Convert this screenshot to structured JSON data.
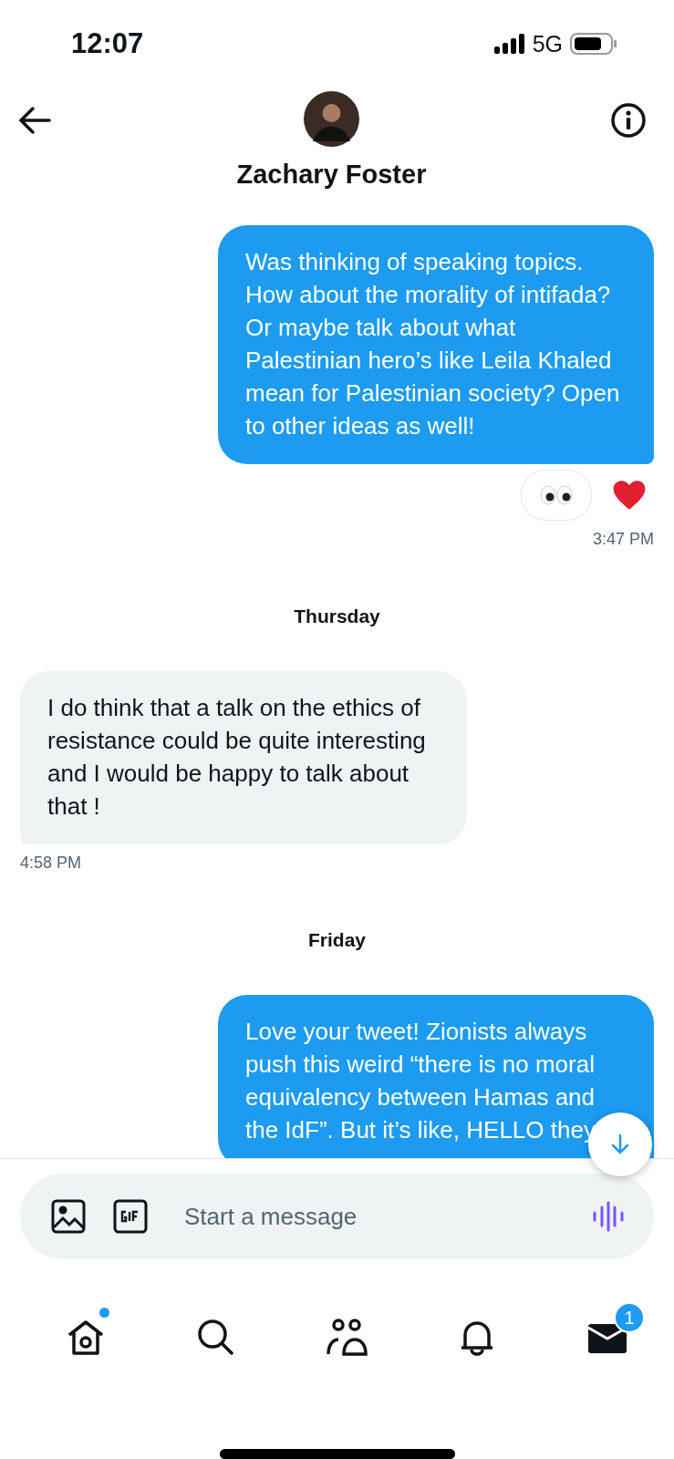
{
  "status_bar": {
    "time": "12:07",
    "network": "5G"
  },
  "header": {
    "name": "Zachary Foster"
  },
  "items": [
    {
      "kind": "sent",
      "text": "Was thinking of speaking topics. How about the morality of intifada? Or maybe talk about what Palestinian hero’s like Leila Khaled mean for Palestinian society? Open to other ideas as well!",
      "reactions": true,
      "time": "3:47 PM"
    },
    {
      "kind": "date",
      "text": "Thursday"
    },
    {
      "kind": "received",
      "text": "I do think that a talk on the ethics of resistance could be quite interesting and I would be happy to talk about that !",
      "time": "4:58 PM"
    },
    {
      "kind": "date",
      "text": "Friday"
    },
    {
      "kind": "sent",
      "text": "Love your tweet! Zionists always push this weird “there is no moral equivalency between Hamas and the IdF”. But it’s like, HELLO they"
    }
  ],
  "composer": {
    "placeholder": "Start a message"
  },
  "tab_bar": {
    "home_dot": true,
    "messages_badge": "1"
  }
}
